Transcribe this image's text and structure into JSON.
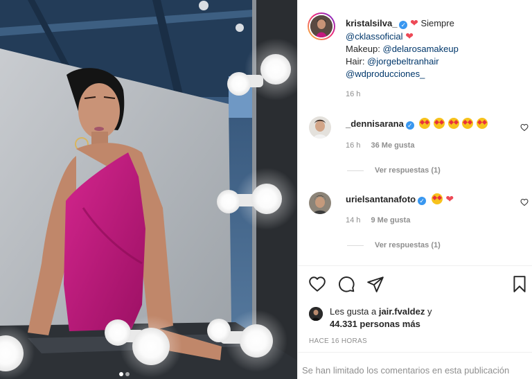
{
  "post": {
    "author": "kristalsilva_",
    "caption_line1_suffix": "Siempre",
    "caption_mention1": "@cklassoficial",
    "caption_makeup_prefix": "Makeup:",
    "caption_makeup_mention": "@delarosamakeup",
    "caption_hair_prefix": "Hair:",
    "caption_hair_mention": "@jorgebeltranhair",
    "caption_mention_last": "@wdproducciones_",
    "time": "16 h"
  },
  "comments": [
    {
      "user": "_dennisarana",
      "time": "16 h",
      "likes": "36 Me gusta",
      "view_replies": "Ver respuestas (1)",
      "emojis": [
        "star-struck",
        "star-struck",
        "star-struck",
        "star-struck",
        "star-struck"
      ]
    },
    {
      "user": "urielsantanafoto",
      "time": "14 h",
      "likes": "9 Me gusta",
      "view_replies": "Ver respuestas (1)",
      "emojis": [
        "star-struck",
        "red-heart"
      ]
    }
  ],
  "likes": {
    "prefix": "Les gusta a",
    "user": "jair.fvaldez",
    "conj": "y",
    "others": "44.331 personas más"
  },
  "timestamp": "HACE 16 HORAS",
  "comments_limited": "Se han limitado los comentarios en esta publicación",
  "icons": {
    "like": "heart-outline-icon",
    "comment": "comment-bubble-icon",
    "share": "paper-plane-icon",
    "save": "bookmark-icon"
  },
  "colors": {
    "link": "#00376b",
    "verified": "#3897f0",
    "muted": "#8e8e8e",
    "dress": "#c41a7e"
  }
}
